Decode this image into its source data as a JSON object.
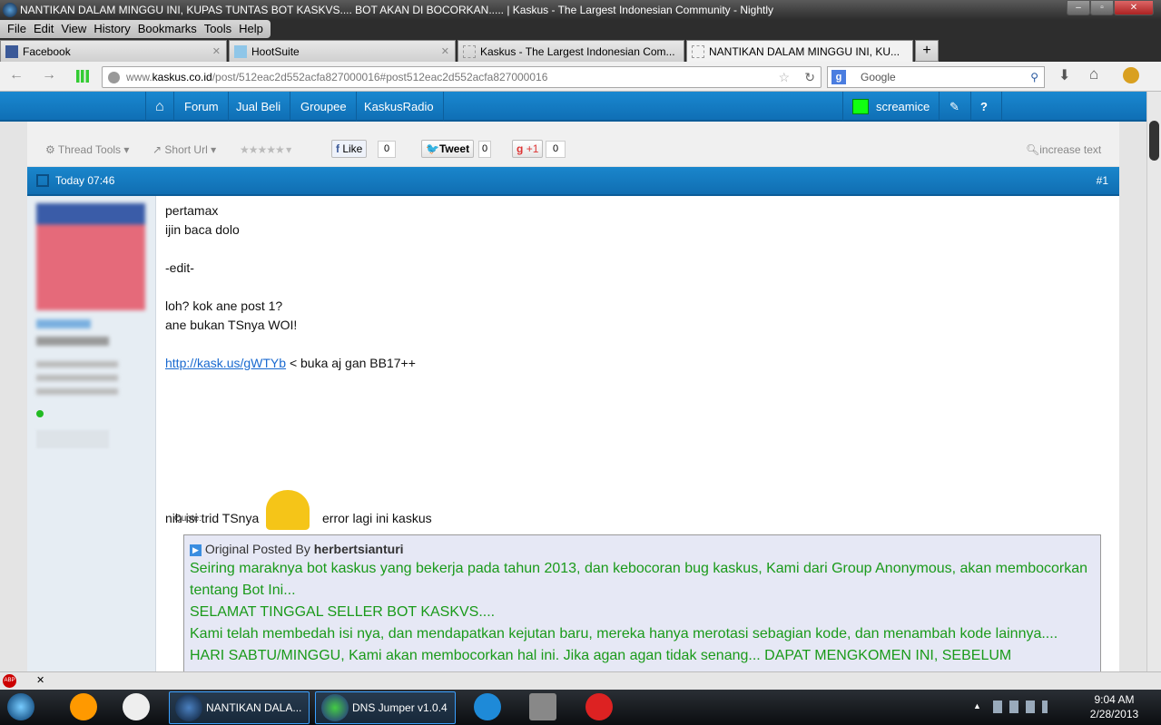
{
  "window": {
    "title": "NANTIKAN DALAM MINGGU INI, KUPAS TUNTAS BOT KASKVS.... BOT AKAN DI BOCORKAN..... | Kaskus - The Largest Indonesian Community - Nightly"
  },
  "menu": [
    "File",
    "Edit",
    "View",
    "History",
    "Bookmarks",
    "Tools",
    "Help"
  ],
  "tabs": [
    {
      "label": "Facebook"
    },
    {
      "label": "HootSuite"
    },
    {
      "label": "Kaskus - The Largest Indonesian Com..."
    },
    {
      "label": "NANTIKAN DALAM MINGGU INI, KU..."
    }
  ],
  "nav": {
    "url_prefix": "www.",
    "url_domain": "kaskus.co.id",
    "url_path": "/post/512eac2d552acfa827000016#post512eac2d552acfa827000016",
    "search_placeholder": "Google"
  },
  "kaskus_nav": {
    "items": [
      "Forum",
      "Jual Beli",
      "Groupee",
      "KaskusRadio"
    ],
    "username": "screamice"
  },
  "toolbar": {
    "thread_tools": "Thread Tools",
    "short_url": "Short Url",
    "like": "Like",
    "like_count": "0",
    "tweet": "Tweet",
    "tweet_count": "0",
    "gplus": "+1",
    "gplus_count": "0",
    "increase_text": "increase text"
  },
  "post": {
    "time": "Today 07:46",
    "number": "#1",
    "lines": [
      "pertamax",
      "ijin baca dolo",
      "",
      "-edit-",
      "",
      "loh? kok ane post 1?",
      "ane bukan TSnya WOI!"
    ],
    "link": "http://kask.us/gWTYb",
    "link_suffix": " < buka aj gan BB17++",
    "trid_before": "nih isi trid TSnya",
    "trid_after": "error lagi ini kaskus",
    "quote_label": "Quote:",
    "quote_by": "Original Posted By",
    "quote_author": "herbertsianturi",
    "quote_lines": [
      "Seiring maraknya bot kaskus yang bekerja pada tahun 2013, dan kebocoran bug kaskus, Kami dari Group Anonymous, akan membocorkan tentang Bot Ini...",
      "SELAMAT TINGGAL SELLER BOT KASKVS....",
      "Kami telah membedah isi nya, dan mendapatkan kejutan baru, mereka hanya merotasi sebagian kode, dan menambah kode lainnya....",
      "HARI SABTU/MINGGU, Kami akan membocorkan hal ini. Jika agan agan tidak senang... DAPAT MENGKOMEN INI, SEBELUM"
    ]
  },
  "taskbar": {
    "items": [
      "NANTIKAN DALA...",
      "DNS Jumper v1.0.4"
    ],
    "time": "9:04 AM",
    "date": "2/28/2013"
  }
}
